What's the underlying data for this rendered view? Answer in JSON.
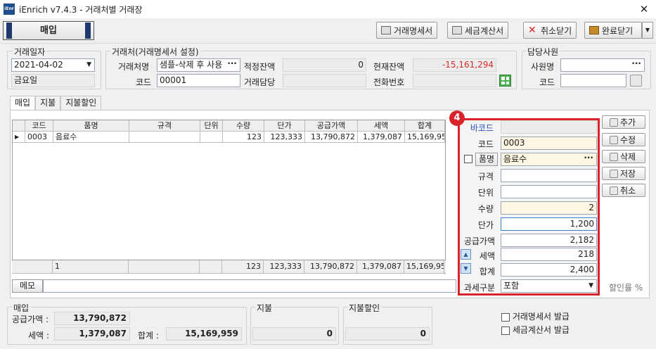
{
  "window": {
    "app_logo": "iEnr",
    "title": "iEnrich v7.4.3 - 거래처별 거래장",
    "close": "✕"
  },
  "toolbar": {
    "mode": "매입",
    "btn_statement": "거래명세서",
    "btn_tax_invoice": "세금계산서",
    "btn_cancel_close": "취소닫기",
    "btn_complete_close": "완료닫기"
  },
  "trade_date": {
    "group": "거래일자",
    "date": "2021-04-02",
    "weekday": "금요일"
  },
  "client": {
    "group": "거래처(거래명세서 설정)",
    "name_label": "거래처명",
    "name_value": "샘플-삭제 후 사용",
    "code_label": "코드",
    "code_value": "00001",
    "opening_label": "적정잔액",
    "opening_value": "0",
    "current_label": "현재잔액",
    "current_value": "-15,161,294",
    "manager_label": "거래담당",
    "manager_value": "",
    "phone_label": "전화번호",
    "phone_value": ""
  },
  "staff": {
    "group": "담당사원",
    "name_label": "사원명",
    "code_label": "코드"
  },
  "tabs": [
    {
      "label": "매입"
    },
    {
      "label": "지불"
    },
    {
      "label": "지불할인"
    }
  ],
  "grid": {
    "headers": [
      "코드",
      "품명",
      "규격",
      "단위",
      "수량",
      "단가",
      "공급가액",
      "세액",
      "합계"
    ],
    "rows": [
      {
        "code": "0003",
        "name": "음료수",
        "spec": "",
        "unit": "",
        "qty": "123",
        "price": "123,333",
        "supply": "13,790,872",
        "tax": "1,379,087",
        "total": "15,169,959"
      }
    ],
    "footer": {
      "count": "1",
      "qty": "123",
      "price": "123,333",
      "supply": "13,790,872",
      "tax": "1,379,087",
      "total": "15,169,959"
    }
  },
  "memo": {
    "label": "메모",
    "value": ""
  },
  "callout": "4",
  "edit": {
    "barcode_label": "바코드",
    "barcode_value": "",
    "code_label": "코드",
    "code_value": "0003",
    "item_label": "품명",
    "item_value": "음료수",
    "spec_label": "규격",
    "spec_value": "",
    "unit_label": "단위",
    "unit_value": "",
    "qty_label": "수량",
    "qty_value": "2",
    "price_label": "단가",
    "price_value": "1,200",
    "supply_label": "공급가액",
    "supply_value": "2,182",
    "tax_label": "세액",
    "tax_value": "218",
    "total_label": "합계",
    "total_value": "2,400",
    "taxtype_label": "과세구분",
    "taxtype_value": "포함"
  },
  "side_buttons": {
    "add": "추가",
    "edit": "수정",
    "delete": "삭제",
    "save": "저장",
    "cancel": "취소"
  },
  "discount_rate_label": "할인률 %",
  "summary": {
    "purchase_group": "매입",
    "supply_label": "공급가액 :",
    "supply_value": "13,790,872",
    "tax_label": "세액 :",
    "tax_value": "1,379,087",
    "total_label": "합계 :",
    "total_value": "15,169,959",
    "payment_group": "지불",
    "payment_value": "0",
    "discount_group": "지불할인",
    "discount_value": "0",
    "issue_statement": "거래명세서 발급",
    "issue_tax_invoice": "세금계산서 발급"
  }
}
